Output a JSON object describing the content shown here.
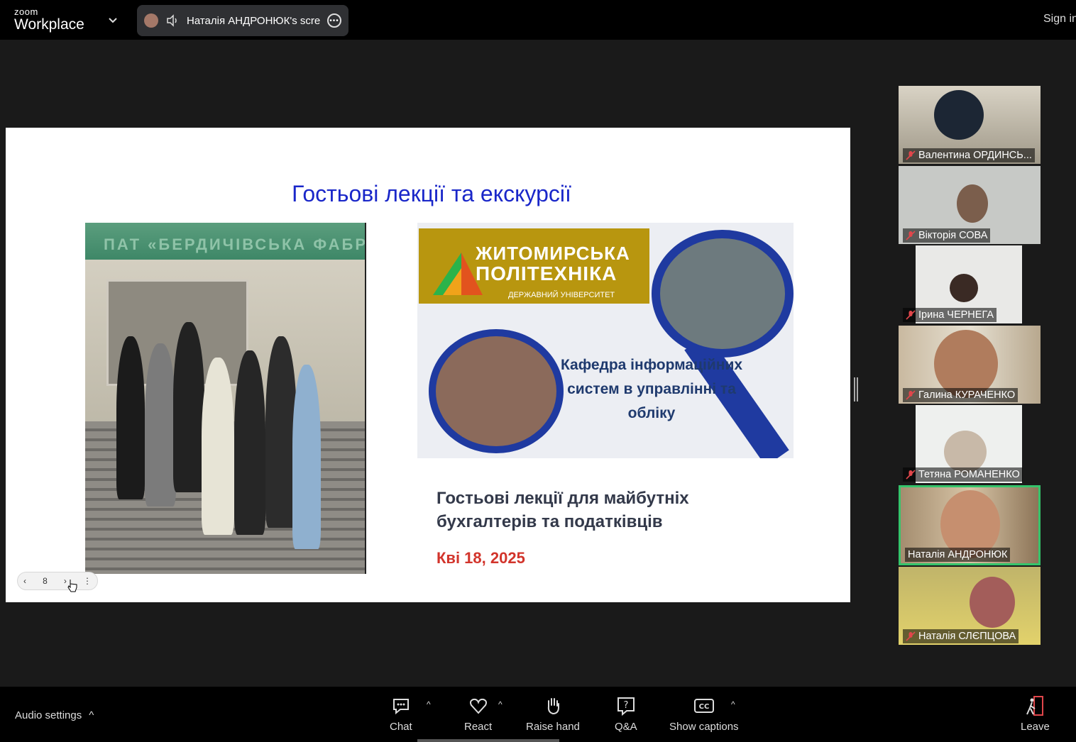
{
  "topbar": {
    "logo_small": "zoom",
    "logo_big": "Workplace",
    "share_label": "Наталія АНДРОНЮК's scree",
    "signin": "Sign in"
  },
  "slide": {
    "title": "Гостьові лекції та екскурсії",
    "photo_sign": "ПАТ «БЕРДИЧІВСЬКА ФАБРИКА»",
    "logo_line1": "ЖИТОМИРСЬКА",
    "logo_line2": "ПОЛІТЕХНІКА",
    "logo_line3": "ДЕРЖАВНИЙ УНІВЕРСИТЕТ",
    "dept": "Кафедра інформаційних систем в управлінні та обліку",
    "caption_line1": "Гостьові лекції для майбутніх",
    "caption_line2": "бухгалтерів та податківців",
    "date": "Кві 18, 2025",
    "page_number": "8"
  },
  "participants": [
    {
      "name": "Валентина ОРДИНСЬ...",
      "muted": true,
      "active": false
    },
    {
      "name": "Вікторія СОВА",
      "muted": true,
      "active": false
    },
    {
      "name": "Ірина ЧЕРНЕГА",
      "muted": true,
      "active": false
    },
    {
      "name": "Галина КУРАЧЕНКО",
      "muted": true,
      "active": false
    },
    {
      "name": "Тетяна РОМАНЕНКО",
      "muted": true,
      "active": false
    },
    {
      "name": "Наталія АНДРОНЮК",
      "muted": false,
      "active": true
    },
    {
      "name": "Наталія СЛЄПЦОВА",
      "muted": true,
      "active": false
    }
  ],
  "toolbar": {
    "audio_settings": "Audio settings",
    "chat": "Chat",
    "react": "React",
    "raise_hand": "Raise hand",
    "qa": "Q&A",
    "show_captions": "Show captions",
    "leave": "Leave"
  },
  "colors": {
    "active_border": "#35c46b",
    "slide_title": "#1a27c9",
    "date": "#d2342b",
    "leave_icon": "#e0464b"
  }
}
